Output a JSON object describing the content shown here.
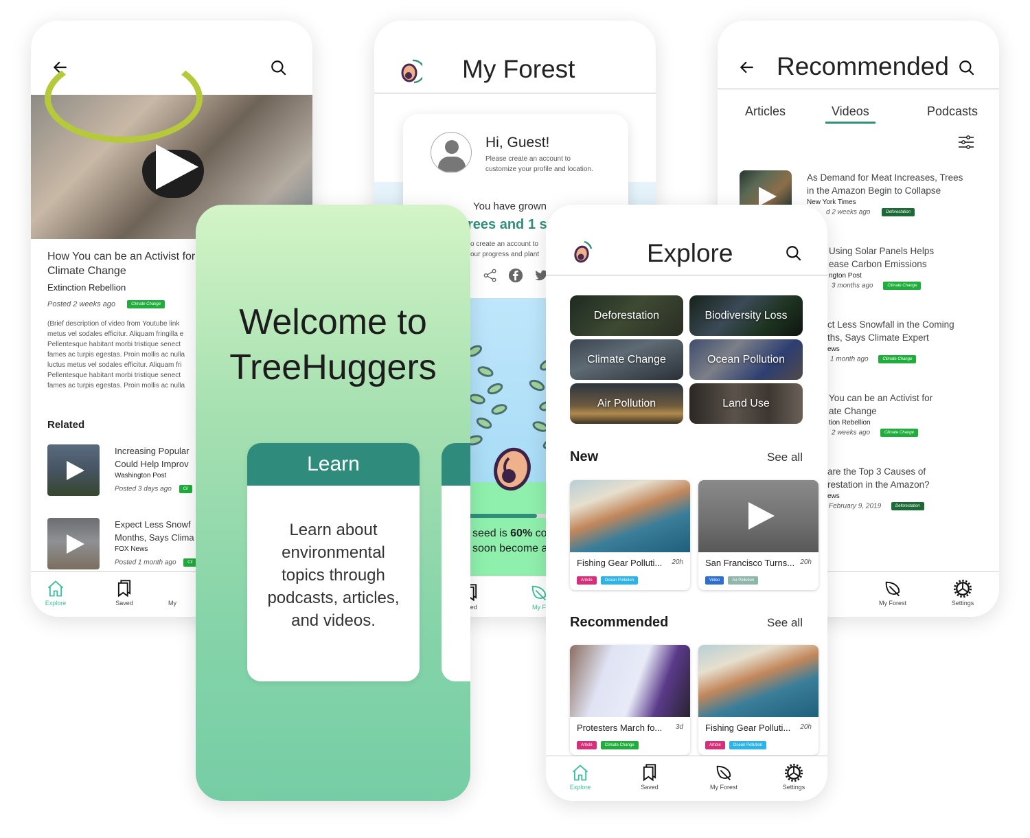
{
  "screen_video_detail": {
    "title": "How You can be an Activist for\nClimate Change",
    "source": "Extinction Rebellion",
    "posted": "Posted 2 weeks ago",
    "tag": "Climate Change",
    "description": "(Brief description of video from Youtube link\nmetus vel sodales efficitur. Aliquam fringilla e\nPellentesque habitant morbi tristique senect\nfames ac turpis egestas. Proin mollis ac nulla\nluctus metus vel sodales efficitur. Aliquam fri\nPellentesque habitant morbi tristique senect\nfames ac turpis egestas. Proin mollis ac nulla",
    "related_heading": "Related",
    "related": [
      {
        "title": "Increasing Popular\nCould Help Improv",
        "source": "Washington Post",
        "posted": "Posted 3 days ago",
        "tag": "Cli"
      },
      {
        "title": "Expect Less Snowf\nMonths, Says Clima",
        "source": "FOX News",
        "posted": "Posted 1 month ago",
        "tag": "Cli"
      }
    ],
    "tabs": [
      {
        "label": "Explore",
        "icon": "home-icon",
        "active": true
      },
      {
        "label": "Saved",
        "icon": "bookmark-icon"
      },
      {
        "label": "My",
        "icon": "leaf-icon"
      }
    ]
  },
  "screen_my_forest": {
    "title": "My Forest",
    "greeting": "Hi, Guest!",
    "greeting_sub": "Please create an account to\ncustomize your profile and location.",
    "grown_label": "You have grown",
    "trees_text": "rees and 1 s",
    "create_text": "o create an account to\nour progress and plant",
    "share_icons": [
      "share-icon",
      "facebook-icon",
      "twitter-icon"
    ],
    "seed_progress_percent": 60,
    "progress_line1_pre": "seed is ",
    "progress_percent_label": "60%",
    "progress_line1_post": " co",
    "progress_line2": "soon become a",
    "tabs": [
      {
        "label": "aved",
        "icon": "bookmark-icon"
      },
      {
        "label": "My F",
        "icon": "leaf-icon",
        "active": true
      }
    ]
  },
  "screen_recommended": {
    "title": "Recommended",
    "segments": [
      {
        "label": "Articles"
      },
      {
        "label": "Videos",
        "active": true
      },
      {
        "label": "Podcasts"
      }
    ],
    "items": [
      {
        "title": "As Demand for Meat Increases, Trees\nin the Amazon Begin to Collapse",
        "source": "New York Times",
        "posted": "d 2 weeks ago",
        "tag": "Deforestation",
        "tag_kind": "defo"
      },
      {
        "title": "Using Solar Panels Helps\nease Carbon Emissions",
        "source": "ngton Post",
        "posted": "3 months ago",
        "tag": "Climate Change",
        "tag_kind": "cc"
      },
      {
        "title": "ct Less Snowfall in the Coming\nths, Says Climate Expert",
        "source": "ews",
        "posted": "1 month ago",
        "tag": "Climate Change",
        "tag_kind": "cc"
      },
      {
        "title": "You can be an Activist for\nate Change",
        "source": "tion Rebellion",
        "posted": "2 weeks ago",
        "tag": "Climate Change",
        "tag_kind": "cc"
      },
      {
        "title": "are the Top 3 Causes of\nrestation in the Amazon?",
        "source": "ews",
        "posted": "February 9, 2019",
        "tag": "Deforestation",
        "tag_kind": "defo"
      }
    ],
    "tabs": [
      {
        "label": "My Forest",
        "icon": "leaf-icon"
      },
      {
        "label": "Settings",
        "icon": "gear-icon"
      }
    ]
  },
  "screen_welcome": {
    "heading": "Welcome to\nTreeHuggers",
    "card_title": "Learn",
    "card_body": "Learn about\nenvironmental\ntopics through\npodcasts, articles,\nand videos."
  },
  "screen_explore": {
    "title": "Explore",
    "categories": [
      "Deforestation",
      "Biodiversity Loss",
      "Climate Change",
      "Ocean Pollution",
      "Air Pollution",
      "Land Use"
    ],
    "new_heading": "New",
    "see_all": "See all",
    "new_items": [
      {
        "title": "Fishing Gear Polluti...",
        "age": "20h",
        "tags": [
          "Article",
          "Ocean Pollution"
        ]
      },
      {
        "title": "San Francisco Turns...",
        "age": "20h",
        "tags": [
          "Video",
          "Air Pollution"
        ]
      }
    ],
    "recommended_heading": "Recommended",
    "recommended_items": [
      {
        "title": "Protesters March fo...",
        "age": "3d",
        "tags": [
          "Article",
          "Climate Change"
        ]
      },
      {
        "title": "Fishing Gear Polluti...",
        "age": "20h",
        "tags": [
          "Article",
          "Ocean Pollution"
        ]
      }
    ],
    "tabs": [
      {
        "label": "Explore",
        "icon": "home-icon",
        "active": true
      },
      {
        "label": "Saved",
        "icon": "bookmark-icon"
      },
      {
        "label": "My Forest",
        "icon": "leaf-icon"
      },
      {
        "label": "Settings",
        "icon": "gear-icon"
      }
    ]
  },
  "colors": {
    "brand_teal": "#2f8b7b",
    "active_tab": "#3bbf9c",
    "tag_climate": "#1fae3b",
    "tag_deforestation": "#1c6b36",
    "tag_article": "#d92f7a",
    "tag_ocean": "#2cb3e8",
    "tag_video": "#2c6fd0",
    "tag_air": "#8fb7a9"
  }
}
